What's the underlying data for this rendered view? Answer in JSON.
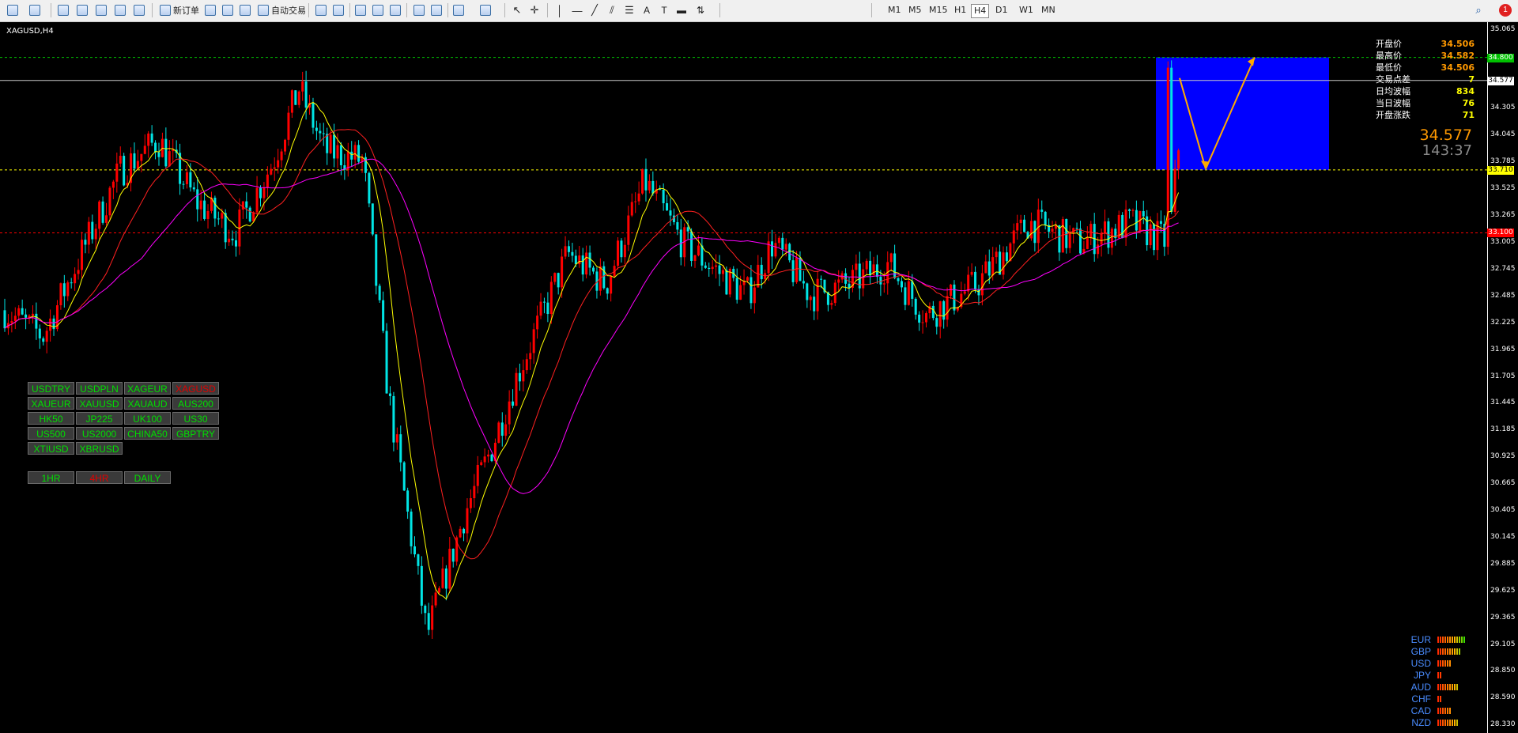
{
  "toolbar": {
    "new_order_label": "新订单",
    "auto_trading_label": "自动交易",
    "timeframes": [
      "M1",
      "M5",
      "M15",
      "H1",
      "H4",
      "D1",
      "W1",
      "MN"
    ],
    "active_timeframe": "H4",
    "notification_count": "1"
  },
  "chart": {
    "symbol_label": "XAGUSD,H4",
    "price_axis": [
      "35.065",
      "34.800",
      "34.577",
      "34.305",
      "34.045",
      "33.785",
      "33.710",
      "33.525",
      "33.265",
      "33.100",
      "33.005",
      "32.745",
      "32.485",
      "32.225",
      "31.965",
      "31.705",
      "31.445",
      "31.185",
      "30.925",
      "30.665",
      "30.405",
      "30.145",
      "29.885",
      "29.625",
      "29.365",
      "29.105",
      "28.850",
      "28.590",
      "28.330"
    ],
    "tagged_levels": {
      "top_green": "34.800",
      "current": "34.577",
      "yellow": "33.710",
      "red": "33.100"
    },
    "colors": {
      "bull": "#ff0000",
      "bear": "#00e5e5",
      "ma_fast": "#ffff00",
      "ma_mid": "#ff2020",
      "ma_slow": "#ff00ff",
      "zone": "#0000ff",
      "arrow": "#ffaa00",
      "green_line": "#00c000",
      "yellow_line": "#ffff00",
      "red_line": "#ff0000"
    }
  },
  "info": {
    "rows": [
      {
        "label": "开盘价",
        "value": "34.506",
        "color": "#ff9900"
      },
      {
        "label": "最高价",
        "value": "34.582",
        "color": "#ff9900"
      },
      {
        "label": "最低价",
        "value": "34.506",
        "color": "#ff9900"
      },
      {
        "label": "交易点差",
        "value": "7",
        "color": "#ffff00"
      },
      {
        "label": "日均波幅",
        "value": "834",
        "color": "#ffff00"
      },
      {
        "label": "当日波幅",
        "value": "76",
        "color": "#ffff00"
      },
      {
        "label": "开盘涨跌",
        "value": "71",
        "color": "#ffff00"
      }
    ],
    "big_price": "34.577",
    "countdown": "143:37"
  },
  "symbols": [
    {
      "label": "USDTRY",
      "selected": false
    },
    {
      "label": "USDPLN",
      "selected": false
    },
    {
      "label": "XAGEUR",
      "selected": false
    },
    {
      "label": "XAGUSD",
      "selected": true
    },
    {
      "label": "XAUEUR",
      "selected": false
    },
    {
      "label": "XAUUSD",
      "selected": false
    },
    {
      "label": "XAUAUD",
      "selected": false
    },
    {
      "label": "AUS200",
      "selected": false
    },
    {
      "label": "HK50",
      "selected": false
    },
    {
      "label": "JP225",
      "selected": false
    },
    {
      "label": "UK100",
      "selected": false
    },
    {
      "label": "US30",
      "selected": false
    },
    {
      "label": "US500",
      "selected": false
    },
    {
      "label": "US2000",
      "selected": false
    },
    {
      "label": "CHINA50",
      "selected": false
    },
    {
      "label": "GBPTRY",
      "selected": false
    },
    {
      "label": "XTIUSD",
      "selected": false
    },
    {
      "label": "XBRUSD",
      "selected": false
    }
  ],
  "timeframe_buttons": [
    {
      "label": "1HR",
      "selected": false
    },
    {
      "label": "4HR",
      "selected": true
    },
    {
      "label": "DAILY",
      "selected": false
    }
  ],
  "strength": [
    {
      "currency": "EUR",
      "level": 12
    },
    {
      "currency": "GBP",
      "level": 10
    },
    {
      "currency": "USD",
      "level": 6
    },
    {
      "currency": "JPY",
      "level": 2
    },
    {
      "currency": "AUD",
      "level": 9
    },
    {
      "currency": "CHF",
      "level": 2
    },
    {
      "currency": "CAD",
      "level": 6
    },
    {
      "currency": "NZD",
      "level": 9
    }
  ]
}
